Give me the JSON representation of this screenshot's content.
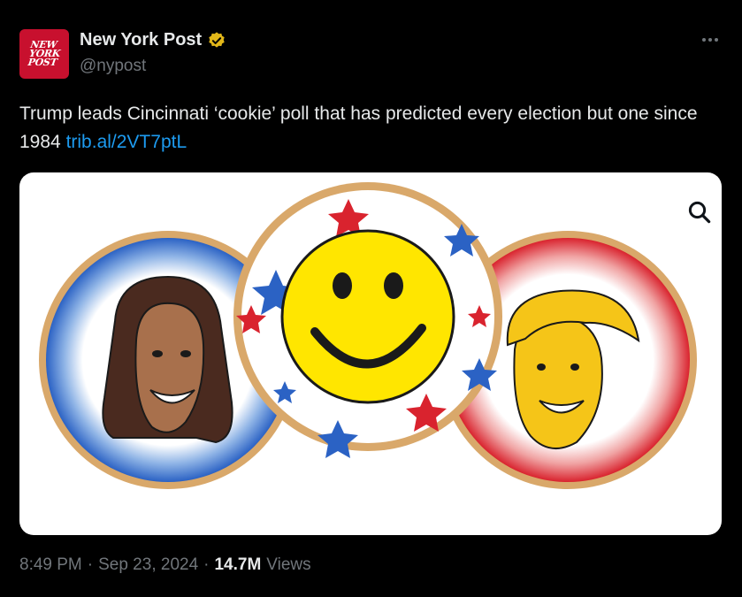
{
  "account": {
    "display_name": "New York Post",
    "handle": "@nypost",
    "logo_text": [
      "NEW",
      "YORK",
      "POST"
    ]
  },
  "tweet": {
    "text": "Trump leads Cincinnati ‘cookie’ poll that has predicted every election but one since 1984",
    "link": "trib.al/2VT7ptL"
  },
  "meta": {
    "time": "8:49 PM",
    "separator1": "·",
    "date": "Sep 23, 2024",
    "separator2": "·",
    "views_count": "14.7M",
    "views_label": "Views"
  },
  "icons": {
    "verified": "verified-badge-icon",
    "more": "more-dots-icon",
    "zoom": "magnifier-icon"
  },
  "colors": {
    "background": "#000000",
    "text_primary": "#e7e9ea",
    "text_secondary": "#71767b",
    "link": "#1d9bf0",
    "verified_gold": "#e2b719",
    "brand_red": "#c8102e"
  }
}
